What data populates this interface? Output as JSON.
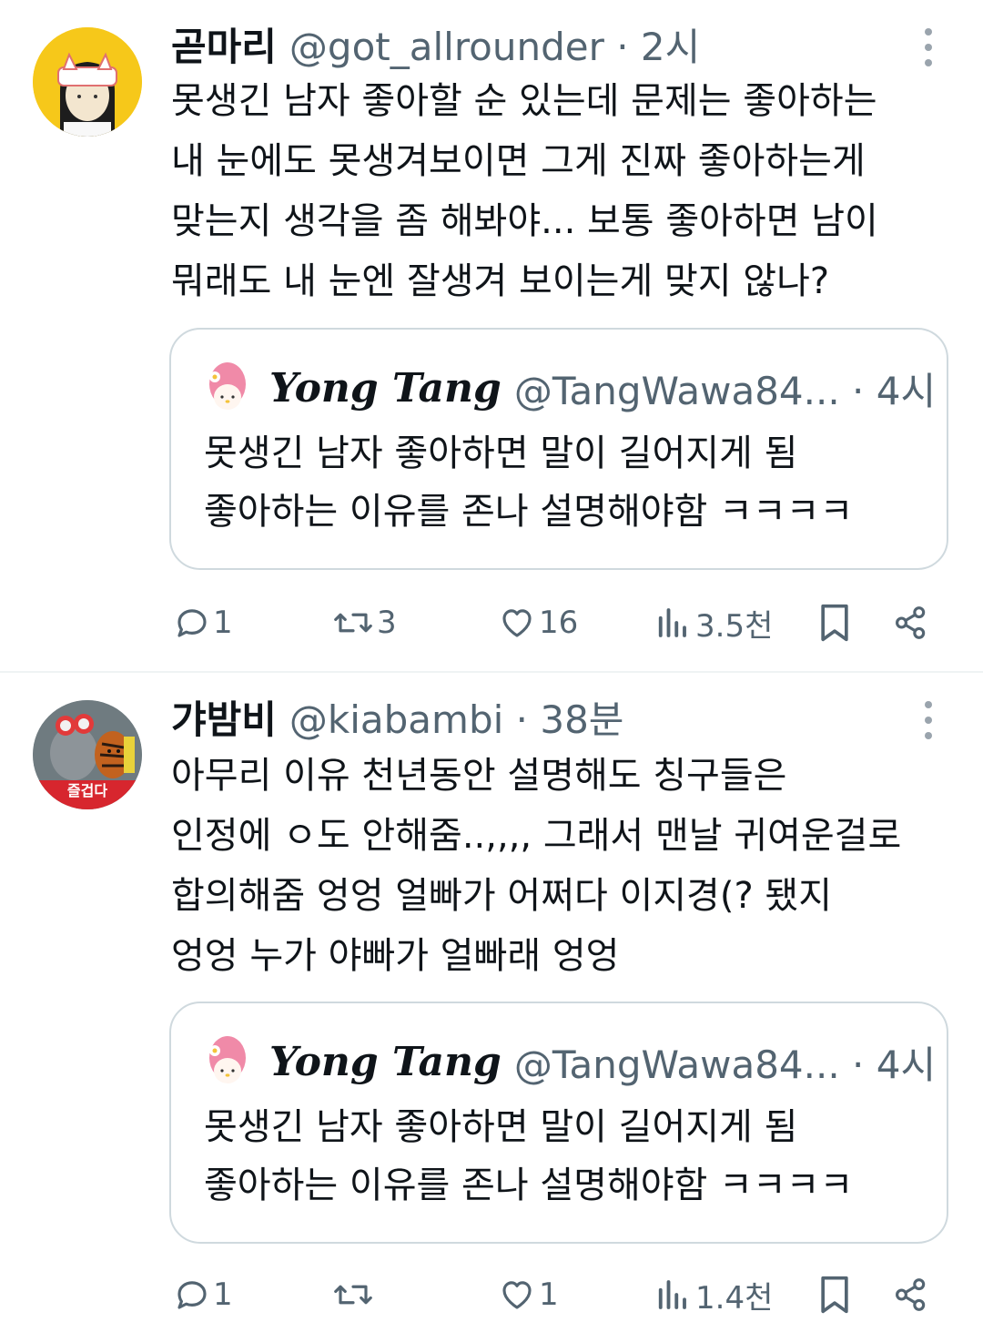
{
  "tweets": [
    {
      "name": "곧마리",
      "handle": "@got_allrounder · 2시",
      "text_lines": [
        "못생긴 남자 좋아할 순 있는데 문제는 좋아하는",
        "내 눈에도 못생겨보이면 그게 진짜 좋아하는게",
        "맞는지 생각을 좀 해봐야... 보통 좋아하면 남이",
        "뭐래도 내 눈엔 잘생겨 보이는게 맞지 않나?"
      ],
      "quote": {
        "name": "Yong Tang",
        "handle": "@TangWawa84... · 4시",
        "text_lines": [
          "못생긴 남자 좋아하면 말이 길어지게 됨",
          "좋아하는 이유를 존나 설명해야함 ㅋㅋㅋㅋ"
        ]
      },
      "actions": {
        "replies": "1",
        "retweets": "3",
        "likes": "16",
        "views": "3.5천"
      },
      "avatar": {
        "icon": "cartoon-girl-avatar",
        "bg": "#f6c81a"
      }
    },
    {
      "name": "갸밤비",
      "handle": "@kiabambi · 38분",
      "text_lines": [
        "아무리 이유 천년동안 설명해도 칭구들은",
        "인정에 ㅇ도 안해줌..,,,, 그래서 맨날 귀여운걸로",
        "합의해줌 엉엉 얼빠가 어쩌다 이지경(? 됐지",
        "엉엉 누가 야빠가 얼빠래 엉엉"
      ],
      "quote": {
        "name": "Yong Tang",
        "handle": "@TangWawa84... · 4시",
        "text_lines": [
          "못생긴 남자 좋아하면 말이 길어지게 됨",
          "좋아하는 이유를 존나 설명해야함 ㅋㅋㅋㅋ"
        ]
      },
      "actions": {
        "replies": "1",
        "retweets": "",
        "likes": "1",
        "views": "1.4천"
      },
      "avatar": {
        "icon": "plush-toys-avatar",
        "badge": "즐겁다",
        "badge_color": "#d7262e"
      }
    }
  ],
  "colors": {
    "text": "#0f1419",
    "secondary": "#536471",
    "border": "#cfd9de"
  }
}
